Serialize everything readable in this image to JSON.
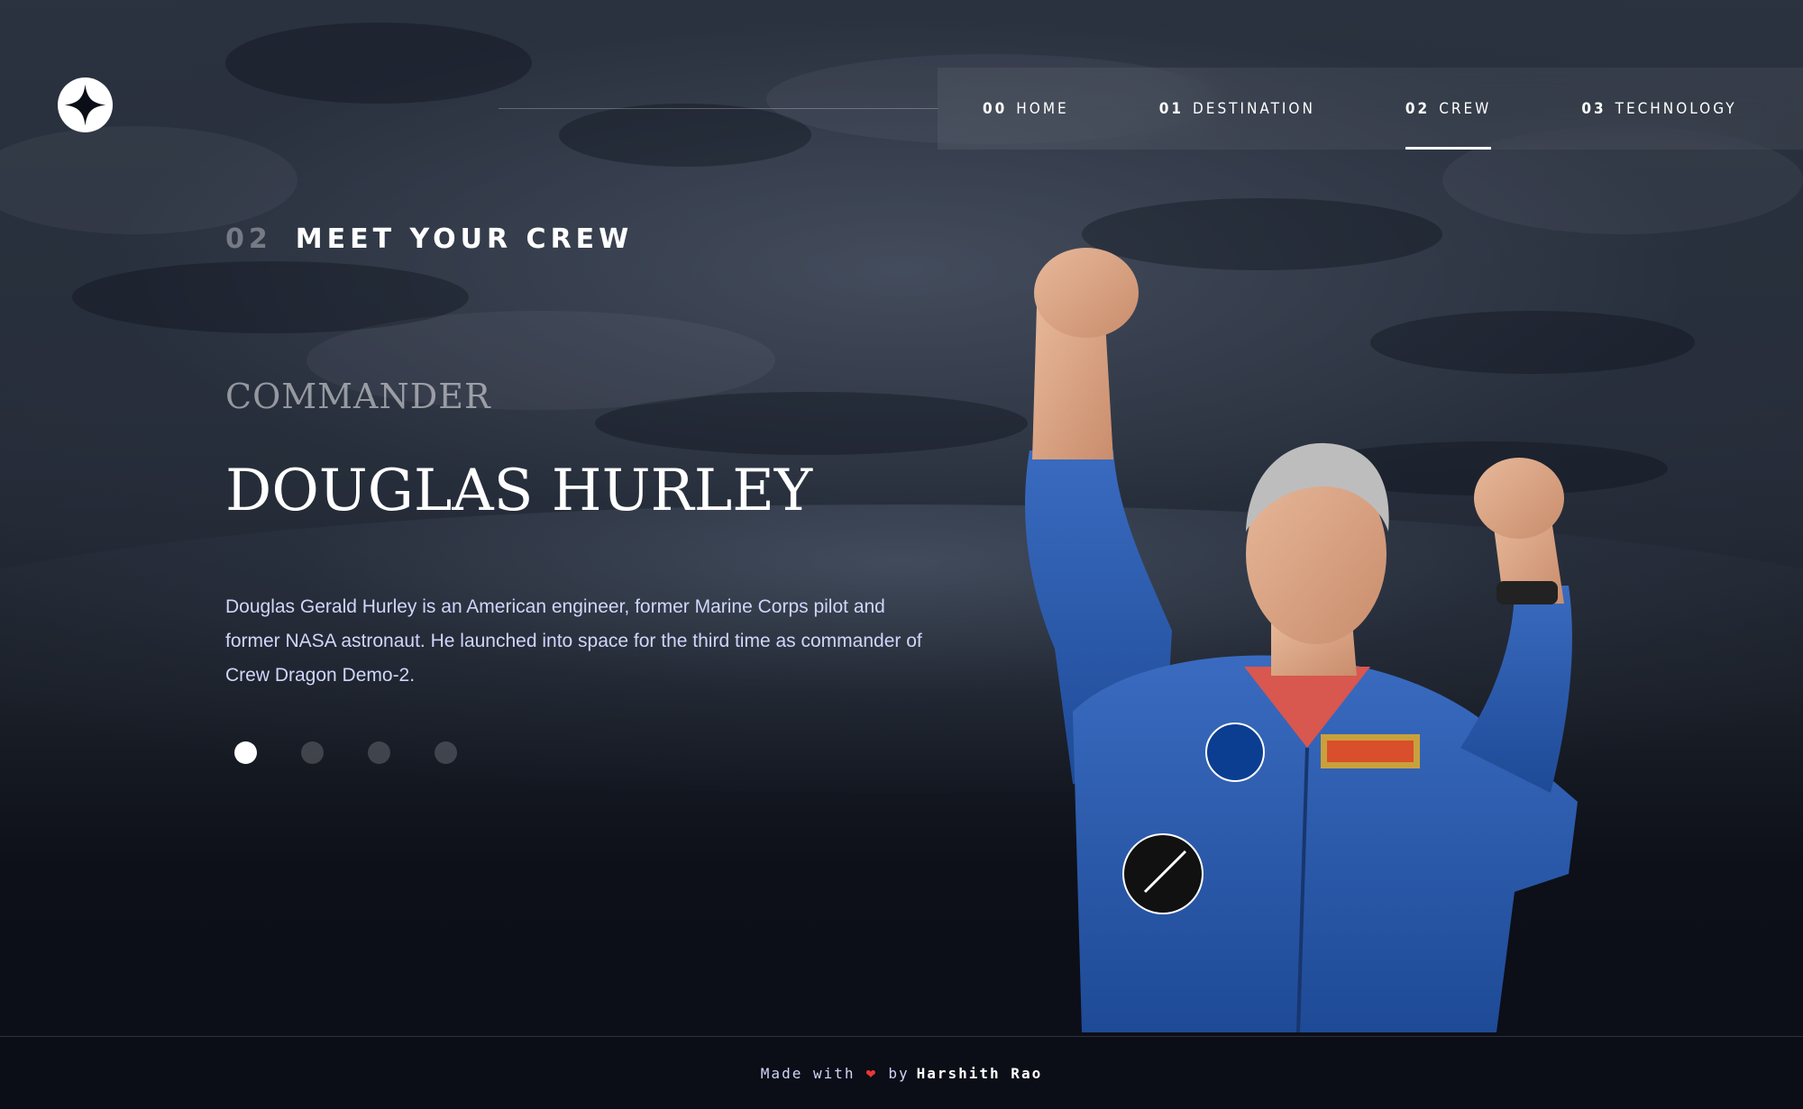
{
  "nav": {
    "items": [
      {
        "num": "00",
        "label": "HOME",
        "active": false
      },
      {
        "num": "01",
        "label": "DESTINATION",
        "active": false
      },
      {
        "num": "02",
        "label": "CREW",
        "active": true
      },
      {
        "num": "03",
        "label": "TECHNOLOGY",
        "active": false
      }
    ]
  },
  "heading": {
    "num": "02",
    "text": "MEET YOUR CREW"
  },
  "crew": {
    "role": "COMMANDER",
    "name": "DOUGLAS HURLEY",
    "bio": "Douglas Gerald Hurley is an American engineer, former Marine Corps pilot and former NASA astronaut. He launched into space for the third time as commander of Crew Dragon Demo-2.",
    "active_index": 0,
    "count": 4
  },
  "footer": {
    "made_with": "Made with",
    "heart": "❤",
    "by": "by",
    "author": "Harshith Rao"
  },
  "colors": {
    "background": "#0b0d17",
    "accent_text": "#d0d6f9",
    "white": "#ffffff",
    "suit_blue": "#2c5aa8"
  },
  "icons": {
    "logo": "star-logo-icon",
    "heart": "heart-icon"
  }
}
